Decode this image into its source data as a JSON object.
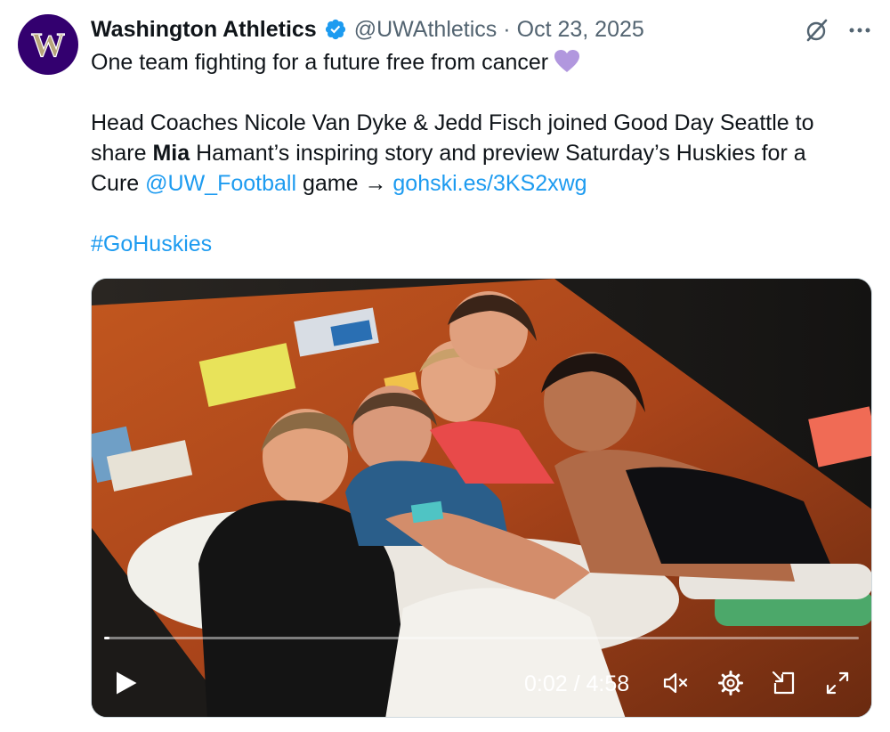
{
  "author": {
    "name": "Washington Athletics",
    "handle": "@UWAthletics",
    "separator": "·",
    "date": "Oct 23, 2025",
    "avatar_letter": "W",
    "verified": true,
    "avatar_color": "#33006f",
    "avatar_letter_color": "#b7a57a"
  },
  "tweet": {
    "line1": "One team fighting for a future free from cancer",
    "heart_icon": "purple-heart-icon",
    "body_part1": "Head Coaches Nicole Van Dyke & Jedd Fisch joined Good Day Seattle to",
    "body_part2_prefix": "share ",
    "body_bold": "Mia",
    "body_part2_suffix": " Hamant’s inspiring story and preview Saturday’s Huskies for a",
    "body_part3_prefix": "Cure ",
    "mention": "@UW_Football",
    "body_part3_mid": " game → ",
    "link": "gohski.es/3KS2xwg",
    "hashtag": "#GoHuskies"
  },
  "video": {
    "current_time": "0:02",
    "divider": "/",
    "duration": "4:58",
    "progress_fraction": 0.007
  },
  "colors": {
    "link": "#1d9bf0",
    "secondary_text": "#536471",
    "verified": "#1d9bf0",
    "heart": "#b197de"
  }
}
